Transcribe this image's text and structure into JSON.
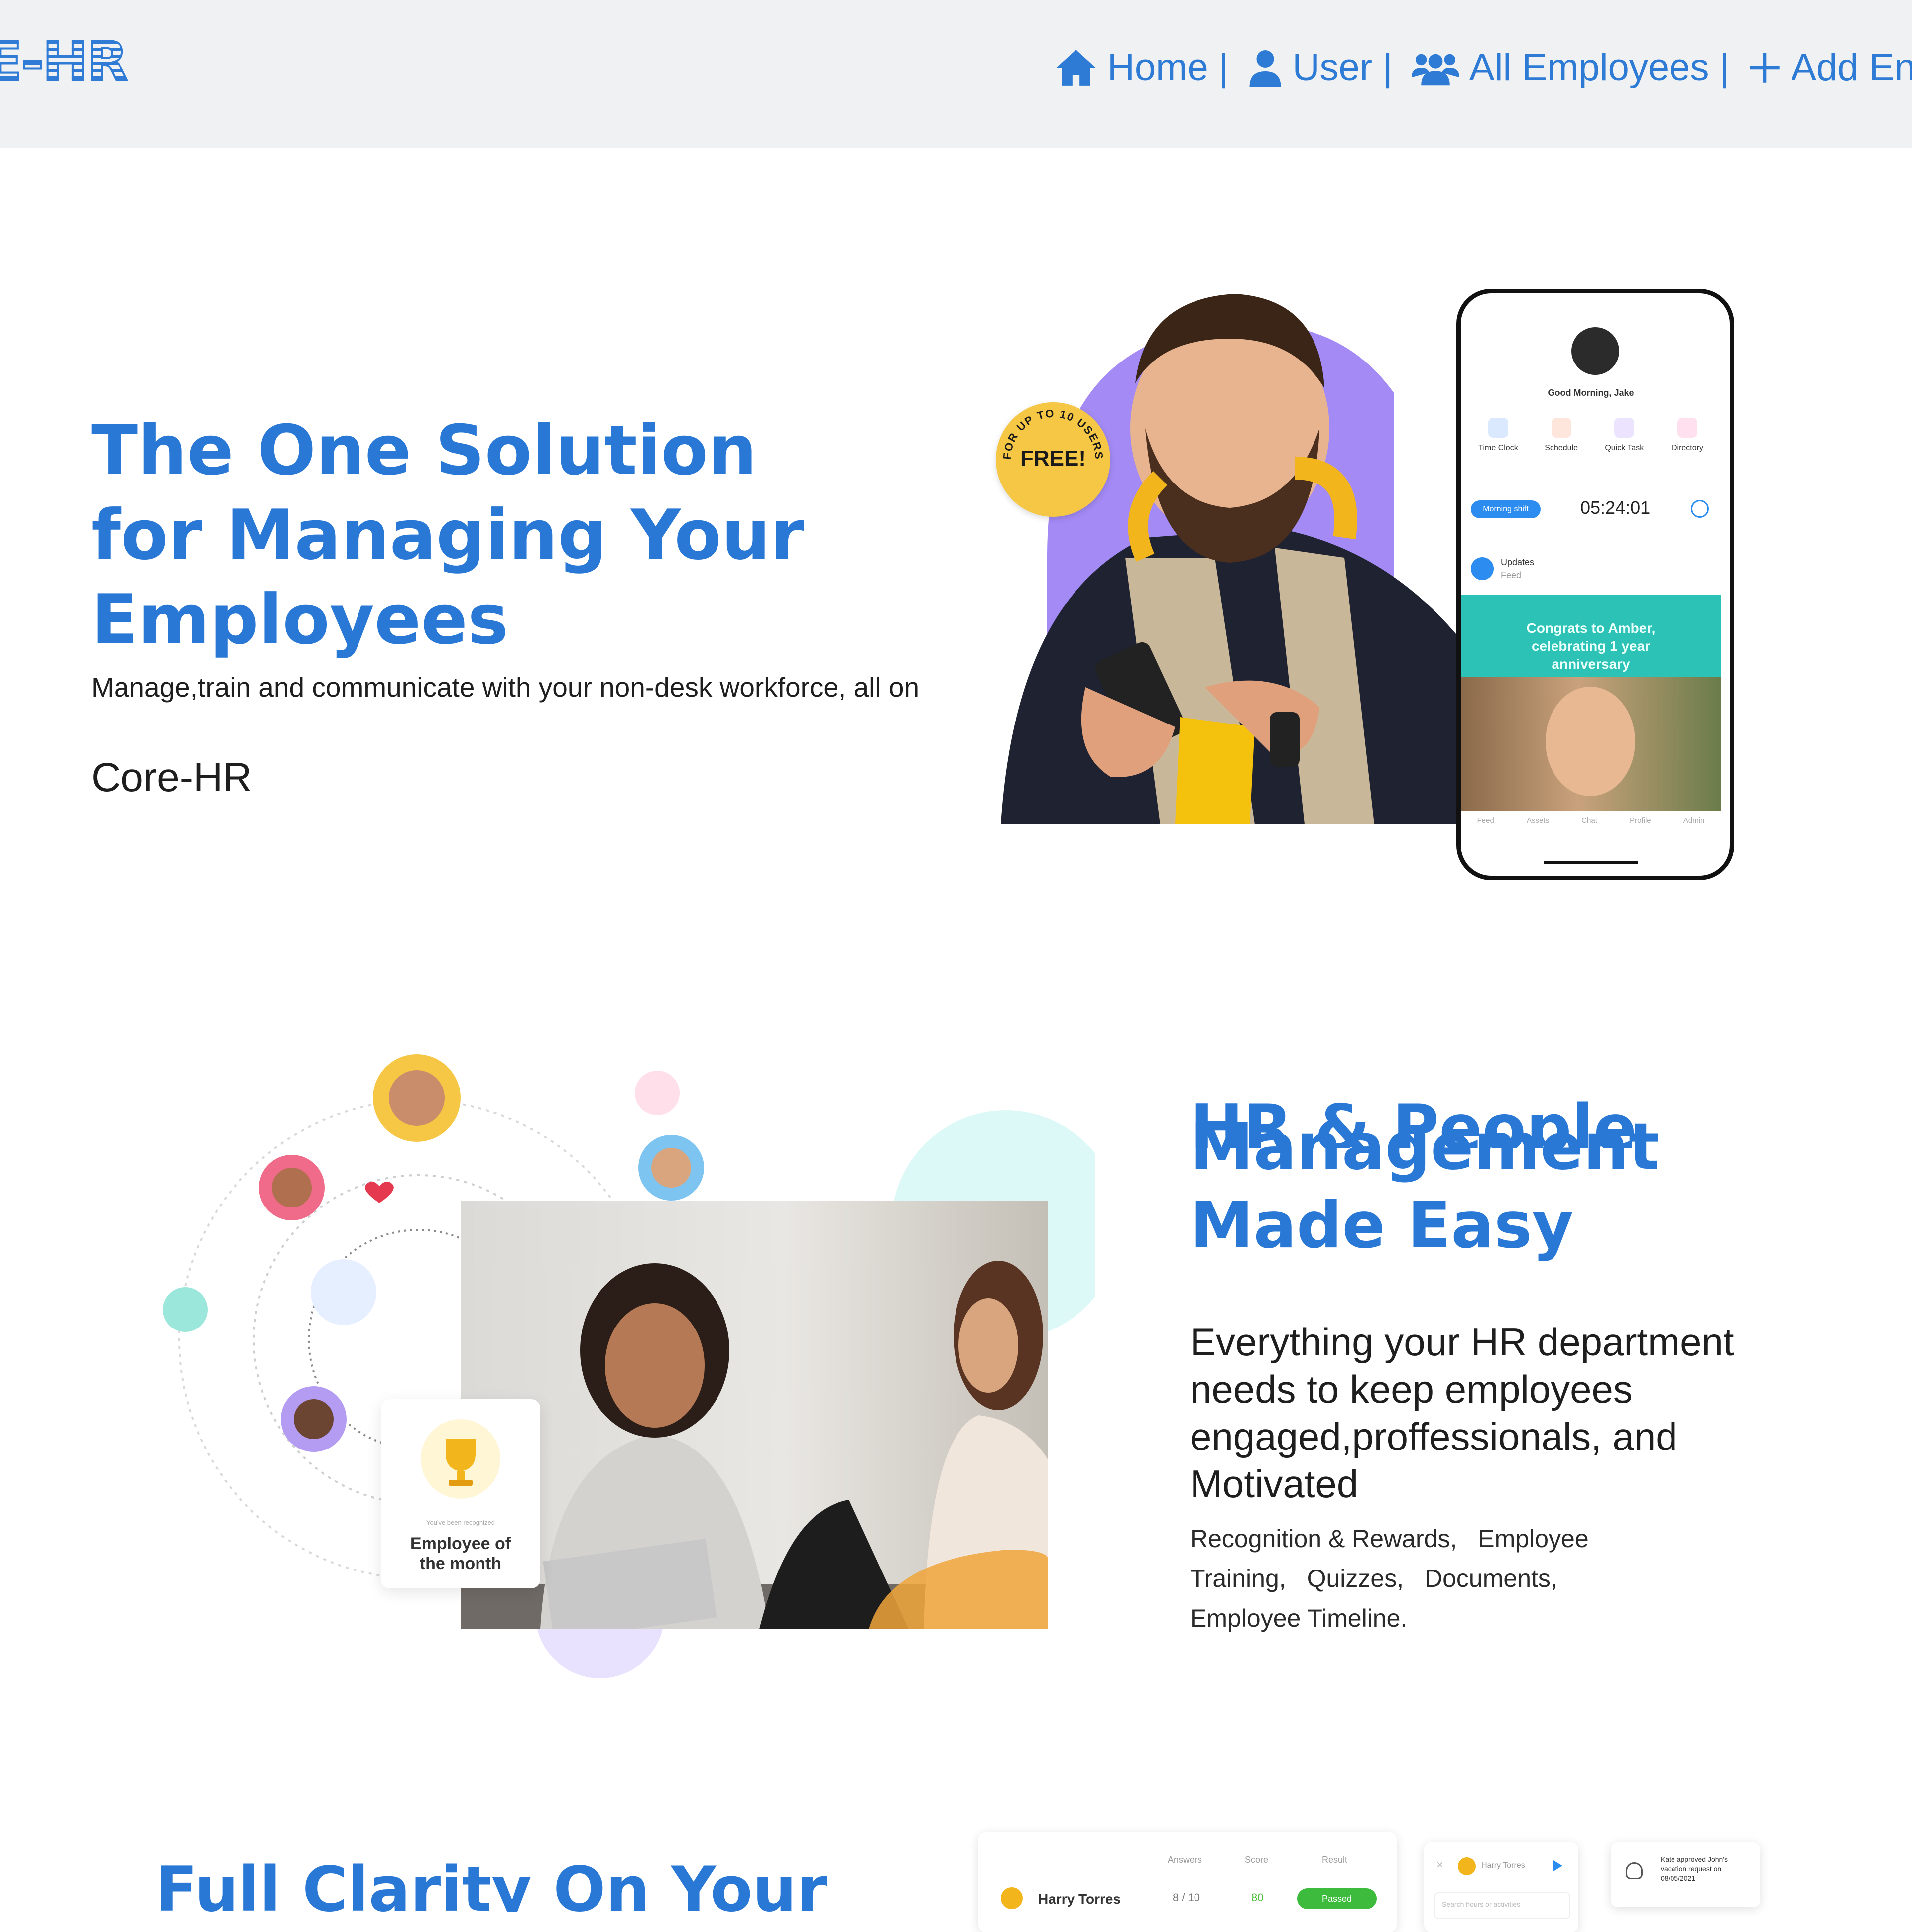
{
  "header": {
    "logo": "RE-HR",
    "nav": [
      {
        "icon": "home-icon",
        "label": "Home |"
      },
      {
        "icon": "user-icon",
        "label": "User |"
      },
      {
        "icon": "users-icon",
        "label": "All Employees |"
      },
      {
        "icon": "plus-icon",
        "label": "Add En"
      }
    ]
  },
  "hero": {
    "title": "The One Solution for Managing Your Employees",
    "subtitle": "Manage,train and communicate with your non-desk workforce, all on",
    "brand": "Core-HR",
    "badge": {
      "main": "FREE!",
      "ring": "FOR UP TO 10 USERS"
    },
    "phone": {
      "greeting": "Good Morning, Jake",
      "shortcuts": [
        "Time Clock",
        "Schedule",
        "Quick Task",
        "Directory"
      ],
      "shift_label": "Morning shift",
      "timer": "05:24:01",
      "updates": "Updates",
      "updates_sub": "Feed",
      "congrats": "Congrats to Amber, celebrating 1 year anniversary",
      "tabs": [
        "Feed",
        "Assets",
        "Chat",
        "Profile",
        "Admin"
      ]
    }
  },
  "section2": {
    "title_partial": "HR & People",
    "title": "Management Made Easy",
    "subtitle": "Everything your HR department needs to keep employees engaged,proffessionals, and Motivated",
    "features": [
      "Recognition & Rewards,",
      "Employee Training,",
      "Quizzes,",
      "Documents,",
      "Employee Timeline."
    ],
    "award_small": "You've been recognized",
    "award": "Employee of the month"
  },
  "section3": {
    "title_partial": "Full Clarity On Your",
    "table": {
      "headers": [
        "Answers",
        "Score",
        "Result"
      ],
      "name": "Harry Torres",
      "answers": "8 / 10",
      "score": "80",
      "result": "Passed"
    },
    "chat_name": "Harry Torres",
    "search_placeholder": "Search hours or activities",
    "notification": "Kate approved John's vacation request on 08/05/2021"
  },
  "colors": {
    "brand": "#2a78d5",
    "nav_bg": "#f0f1f3",
    "teal": "#2dc3b5",
    "purple": "#a78bfa",
    "yellow": "#f6c744"
  }
}
